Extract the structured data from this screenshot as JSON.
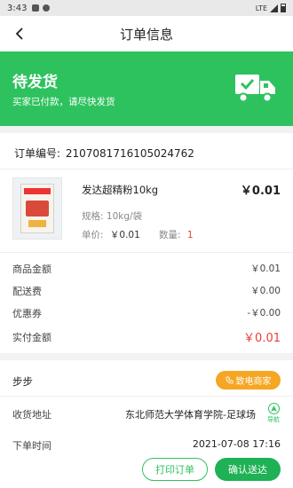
{
  "status_bar": {
    "time": "3:43",
    "network": "LTE"
  },
  "nav": {
    "title": "订单信息"
  },
  "banner": {
    "state": "待发货",
    "subtitle": "买家已付款，请尽快发货",
    "icon": "truck-check-icon"
  },
  "order": {
    "number_label": "订单编号:",
    "number": "2107081716105024762"
  },
  "product": {
    "name": "发达超精粉10kg",
    "price": "￥0.01",
    "spec_label": "规格:",
    "spec": "10kg/袋",
    "unit_price_label": "单价:",
    "unit_price": "￥0.01",
    "qty_label": "数量:",
    "qty": "1"
  },
  "summary": [
    {
      "label": "商品金额",
      "value": "￥0.01"
    },
    {
      "label": "配送费",
      "value": "￥0.00"
    },
    {
      "label": "优惠券",
      "value": "-￥0.00"
    },
    {
      "label": "实付金额",
      "value": "￥0.01"
    }
  ],
  "merchant": {
    "name": "步步",
    "call_label": "致电商家"
  },
  "address": {
    "label": "收货地址",
    "value": "东北师范大学体育学院-足球场",
    "nav_label": "导航"
  },
  "order_time": {
    "label": "下单时间",
    "value": "2021-07-08 17:16"
  },
  "actions": {
    "print_label": "打印订单",
    "confirm_label": "确认送达"
  },
  "colors": {
    "accent": "#2ec25e",
    "call": "#f5a623",
    "price_red": "#e8403a"
  }
}
